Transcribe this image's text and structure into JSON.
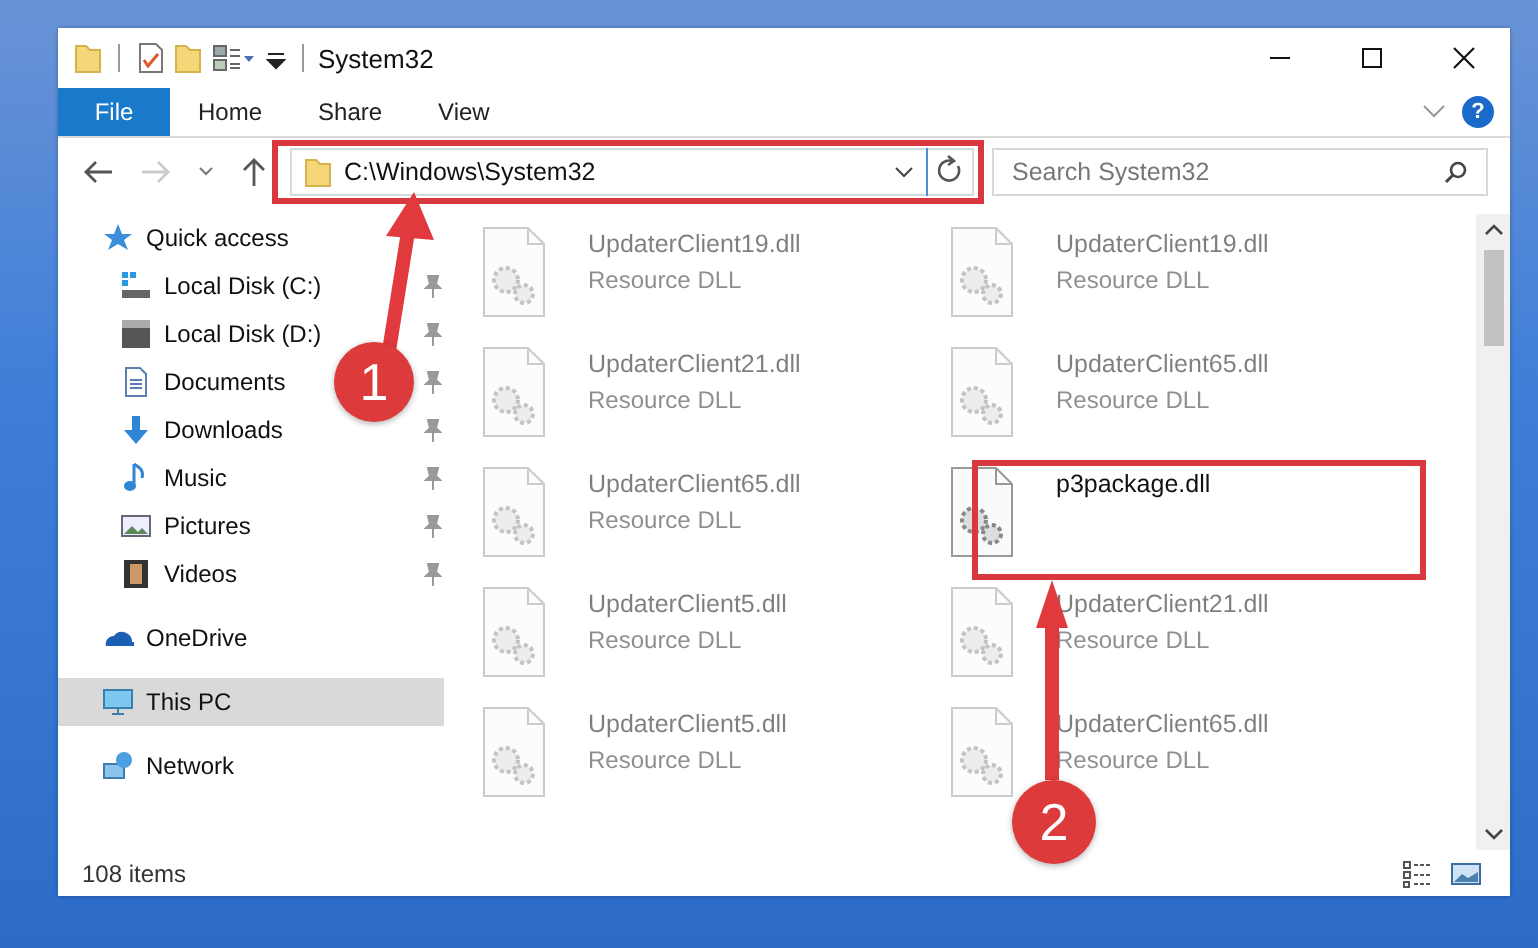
{
  "window": {
    "title": "System32"
  },
  "ribbon": {
    "tabs": [
      {
        "label": "File",
        "selected": true
      },
      {
        "label": "Home",
        "selected": false
      },
      {
        "label": "Share",
        "selected": false
      },
      {
        "label": "View",
        "selected": false
      }
    ],
    "help_button": "?"
  },
  "address_bar": {
    "path": "C:\\Windows\\System32"
  },
  "search": {
    "placeholder": "Search System32"
  },
  "navigation": [
    {
      "label": "Quick access",
      "kind": "star",
      "children": [
        {
          "label": "Local Disk (C:)",
          "kind": "systemdrive",
          "pinned": true
        },
        {
          "label": "Local Disk (D:)",
          "kind": "drive",
          "pinned": true
        },
        {
          "label": "Documents",
          "kind": "documents",
          "pinned": true
        },
        {
          "label": "Downloads",
          "kind": "downloads",
          "pinned": true
        },
        {
          "label": "Music",
          "kind": "music",
          "pinned": true
        },
        {
          "label": "Pictures",
          "kind": "pictures",
          "pinned": true
        },
        {
          "label": "Videos",
          "kind": "videos",
          "pinned": true
        }
      ]
    },
    {
      "label": "OneDrive",
      "kind": "cloud",
      "selected": false
    },
    {
      "label": "This PC",
      "kind": "pc",
      "selected": true
    },
    {
      "label": "Network",
      "kind": "network",
      "selected": false
    }
  ],
  "files": [
    {
      "name": "UpdaterClient19.dll",
      "type": "Resource DLL",
      "faded": true
    },
    {
      "name": "UpdaterClient19.dll",
      "type": "Resource DLL",
      "faded": true
    },
    {
      "name": "UpdaterClient21.dll",
      "type": "Resource DLL",
      "faded": true
    },
    {
      "name": "UpdaterClient65.dll",
      "type": "Resource DLL",
      "faded": true
    },
    {
      "name": "UpdaterClient65.dll",
      "type": "Resource DLL",
      "faded": true
    },
    {
      "name": "p3package.dll",
      "faded": false
    },
    {
      "name": "UpdaterClient5.dll",
      "type": "Resource DLL",
      "faded": true
    },
    {
      "name": "UpdaterClient21.dll",
      "type": "Resource DLL",
      "faded": true
    },
    {
      "name": "UpdaterClient5.dll",
      "type": "Resource DLL",
      "faded": true
    },
    {
      "name": "UpdaterClient65.dll",
      "type": "Resource DLL",
      "faded": true
    }
  ],
  "status_bar": {
    "item_count": "108 items"
  },
  "annotations": [
    {
      "label": "1"
    },
    {
      "label": "2"
    }
  ]
}
